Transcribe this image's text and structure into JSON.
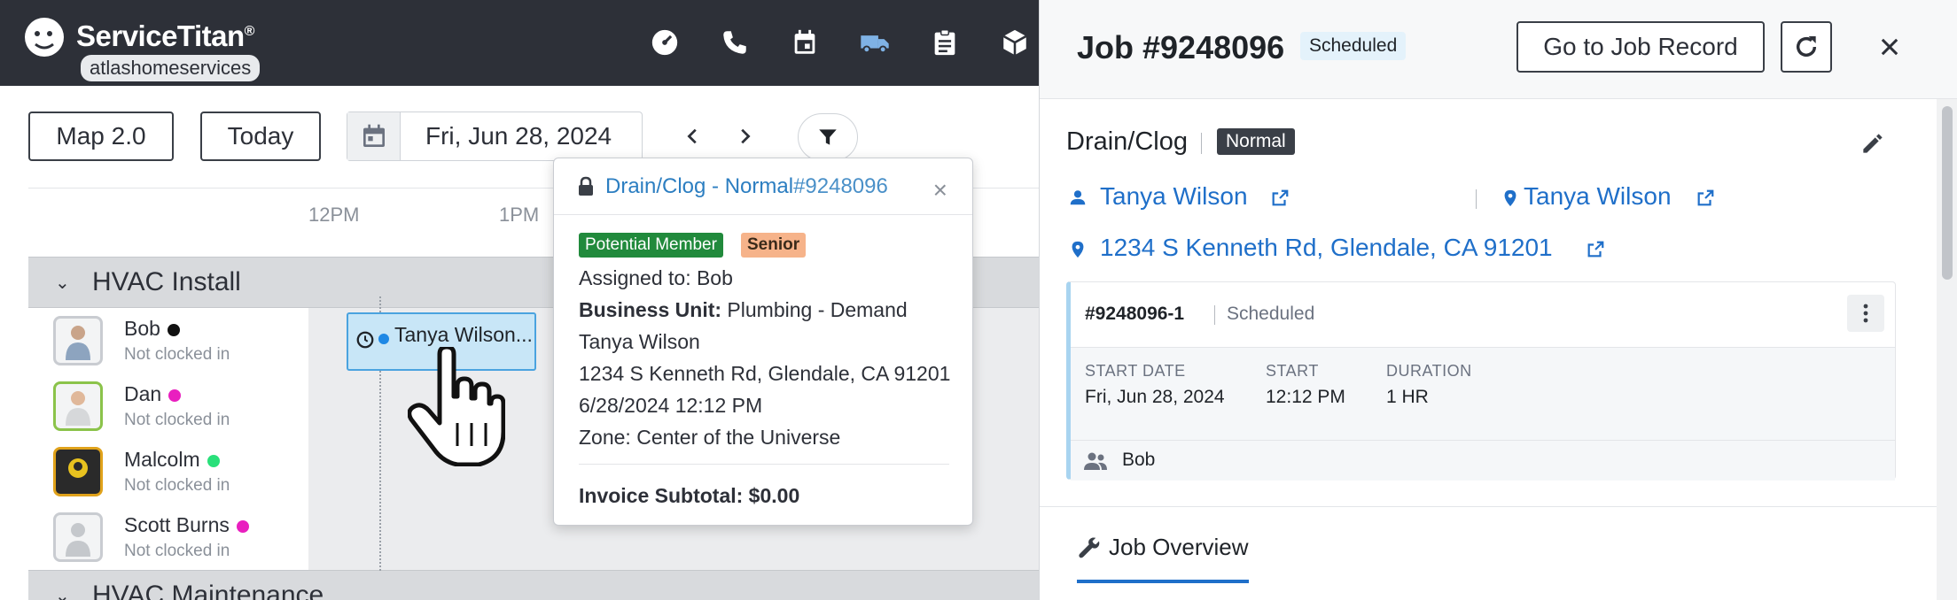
{
  "brand": {
    "name": "ServiceTitan",
    "trademark": "®",
    "tenant": "atlashomeservices"
  },
  "nav": {
    "icons": [
      "dashboard-icon",
      "phone-icon",
      "calendar-icon",
      "truck-icon",
      "clipboard-icon",
      "box-icon"
    ],
    "active": "truck-icon"
  },
  "toolbar": {
    "map_label": "Map 2.0",
    "today_label": "Today",
    "date": "Fri, Jun 28, 2024"
  },
  "timeline": {
    "times": [
      "12PM",
      "1PM"
    ]
  },
  "groups": [
    {
      "name": "HVAC Install"
    },
    {
      "name": "HVAC Maintenance"
    }
  ],
  "technicians": [
    {
      "name": "Bob",
      "status": "Not clocked in",
      "dot_color": "#111111"
    },
    {
      "name": "Dan",
      "status": "Not clocked in",
      "dot_color": "#e91fbf"
    },
    {
      "name": "Malcolm",
      "status": "Not clocked in",
      "dot_color": "#29e07a"
    },
    {
      "name": "Scott Burns",
      "status": "Not clocked in",
      "dot_color": "#e91fbf"
    }
  ],
  "job_block": {
    "label": "Tanya Wilson..."
  },
  "popup": {
    "title": "Drain/Clog - Normal",
    "job_number": "#9248096",
    "close": "×",
    "badges": [
      "Potential Member",
      "Senior"
    ],
    "assigned": "Assigned to: Bob",
    "business_unit_label": "Business Unit:",
    "business_unit_value": " Plumbing - Demand",
    "customer": "Tanya Wilson",
    "address": "1234 S Kenneth Rd, Glendale, CA 91201",
    "datetime": "6/28/2024 12:12 PM",
    "zone": "Zone: Center of the Universe",
    "invoice": "Invoice Subtotal: $0.00"
  },
  "panel": {
    "job_title": "Job #9248096",
    "status": "Scheduled",
    "goto_label": "Go to Job Record",
    "job_type": "Drain/Clog",
    "priority": "Normal",
    "customer_link": "Tanya Wilson",
    "location_link": "Tanya Wilson",
    "address_link": "1234 S Kenneth Rd, Glendale, CA 91201",
    "appointment": {
      "id": "#9248096-1",
      "status": "Scheduled",
      "start_date_label": "START DATE",
      "start_date": "Fri, Jun 28, 2024",
      "start_label": "START",
      "start": "12:12 PM",
      "duration_label": "DURATION",
      "duration": "1 HR",
      "crew": "Bob"
    },
    "tab_label": "Job Overview"
  },
  "colors": {
    "accent": "#1f6fc9",
    "topbar": "#2d3038",
    "job_block": "#c8e6f7"
  }
}
